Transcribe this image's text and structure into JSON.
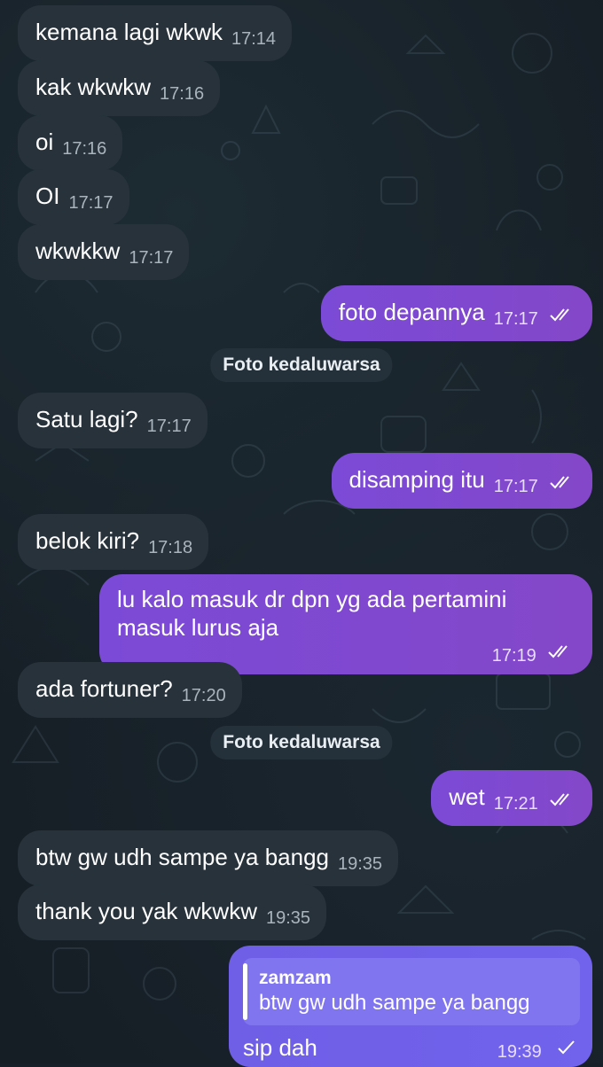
{
  "colors": {
    "background": "#161e25",
    "incoming_bubble": "#27323b",
    "outgoing_bubble": "#7b4ad6",
    "reply_bubble": "#6d61e6",
    "service_badge": "#25313a"
  },
  "messages": [
    {
      "direction": "in",
      "text": "kemana lagi wkwk",
      "time": "17:14"
    },
    {
      "direction": "in",
      "text": "kak wkwkw",
      "time": "17:16"
    },
    {
      "direction": "in",
      "text": "oi",
      "time": "17:16"
    },
    {
      "direction": "in",
      "text": "OI",
      "time": "17:17"
    },
    {
      "direction": "in",
      "text": "wkwkkw",
      "time": "17:17"
    },
    {
      "direction": "out",
      "text": "foto depannya",
      "time": "17:17",
      "status": "read-double-check-icon"
    },
    {
      "type": "service",
      "text": "Foto kedaluwarsa"
    },
    {
      "direction": "in",
      "text": "Satu lagi?",
      "time": "17:17"
    },
    {
      "direction": "out",
      "text": "disamping itu",
      "time": "17:17",
      "status": "read-double-check-icon"
    },
    {
      "direction": "in",
      "text": "belok kiri?",
      "time": "17:18"
    },
    {
      "direction": "out",
      "text": "lu kalo masuk dr dpn yg ada pertamini masuk lurus aja",
      "time": "17:19",
      "status": "read-double-check-icon"
    },
    {
      "direction": "in",
      "text": "ada fortuner?",
      "time": "17:20"
    },
    {
      "type": "service",
      "text": "Foto kedaluwarsa"
    },
    {
      "direction": "out",
      "text": "wet",
      "time": "17:21",
      "status": "read-double-check-icon"
    },
    {
      "direction": "in",
      "text": "btw gw udh sampe ya bangg",
      "time": "19:35"
    },
    {
      "direction": "in",
      "text": "thank you yak wkwkw",
      "time": "19:35"
    },
    {
      "direction": "out",
      "reply_to": {
        "name": "zamzam",
        "text": "btw gw udh sampe ya bangg"
      },
      "text": "sip dah",
      "time": "19:39",
      "status": "sent-single-check-icon"
    }
  ]
}
